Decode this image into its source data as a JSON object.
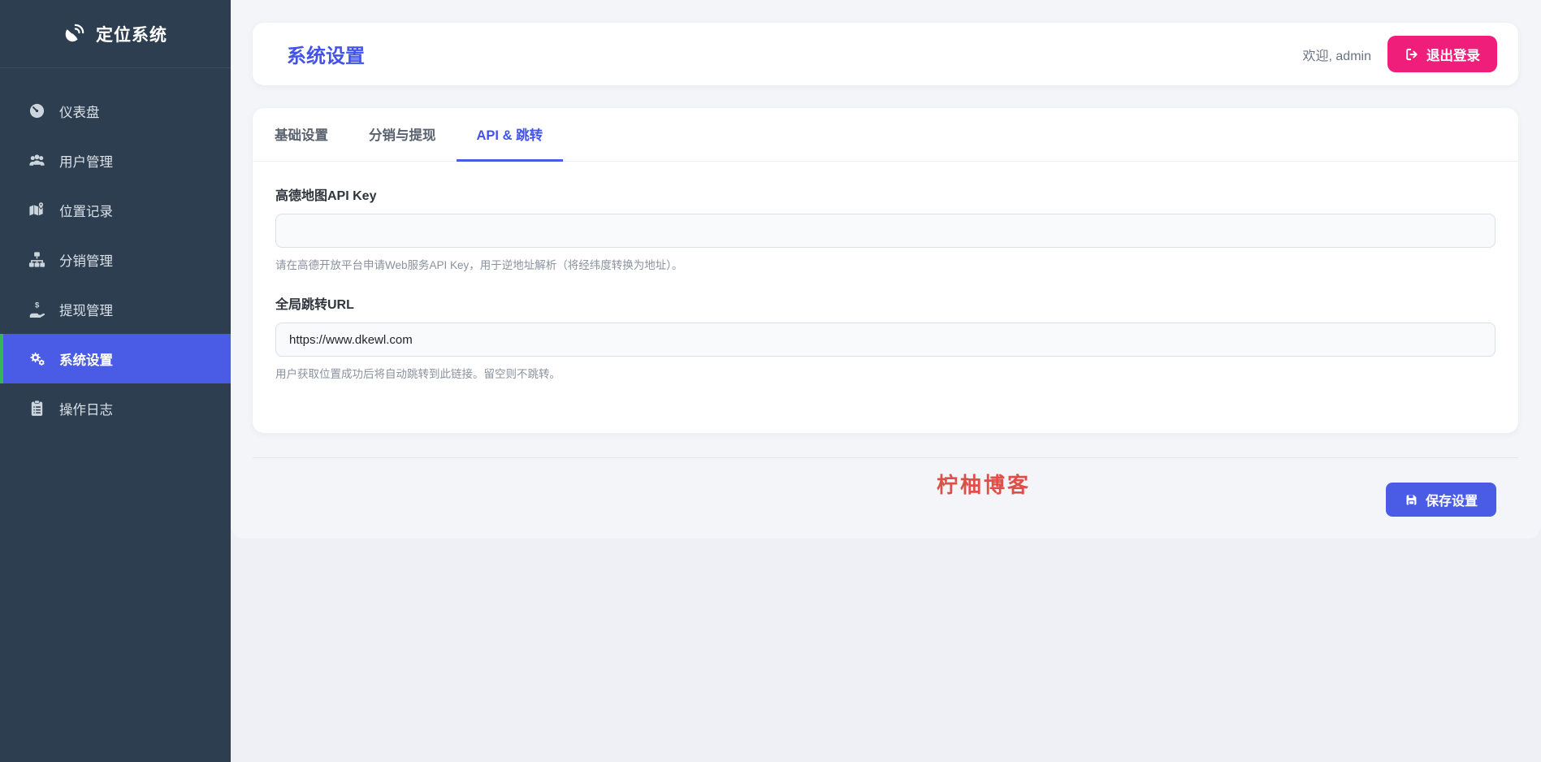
{
  "app": {
    "title": "定位系统",
    "logo_icon": "satellite-dish-icon"
  },
  "sidebar": {
    "items": [
      {
        "label": "仪表盘",
        "icon": "gauge-icon",
        "active": false
      },
      {
        "label": "用户管理",
        "icon": "users-icon",
        "active": false
      },
      {
        "label": "位置记录",
        "icon": "map-marked-icon",
        "active": false
      },
      {
        "label": "分销管理",
        "icon": "sitemap-icon",
        "active": false
      },
      {
        "label": "提现管理",
        "icon": "hand-holding-dollar-icon",
        "active": false
      },
      {
        "label": "系统设置",
        "icon": "gears-icon",
        "active": true
      },
      {
        "label": "操作日志",
        "icon": "clipboard-list-icon",
        "active": false
      }
    ]
  },
  "header": {
    "title": "系统设置",
    "welcome": "欢迎, admin",
    "logout": {
      "label": "退出登录",
      "icon": "sign-out-icon"
    }
  },
  "tabs": [
    {
      "label": "基础设置",
      "active": false
    },
    {
      "label": "分销与提现",
      "active": false
    },
    {
      "label": "API & 跳转",
      "active": true
    }
  ],
  "form": {
    "fields": [
      {
        "label": "高德地图API Key",
        "value": "",
        "help": "请在高德开放平台申请Web服务API Key，用于逆地址解析（将经纬度转换为地址）。"
      },
      {
        "label": "全局跳转URL",
        "value": "https://www.dkewl.com",
        "help": "用户获取位置成功后将自动跳转到此链接。留空则不跳转。"
      }
    ]
  },
  "footer": {
    "watermark": "柠柚博客",
    "save": {
      "label": "保存设置",
      "icon": "save-icon"
    }
  },
  "colors": {
    "sidebar_bg": "#2c3e50",
    "accent_blue": "#4a5ce5",
    "title_blue": "#4353e8",
    "logout_pink": "#ef1e7b",
    "active_border_green": "#35b558",
    "watermark_red": "#db5147",
    "page_bg": "#f3f5f9",
    "body_bg": "#eef0f5"
  }
}
